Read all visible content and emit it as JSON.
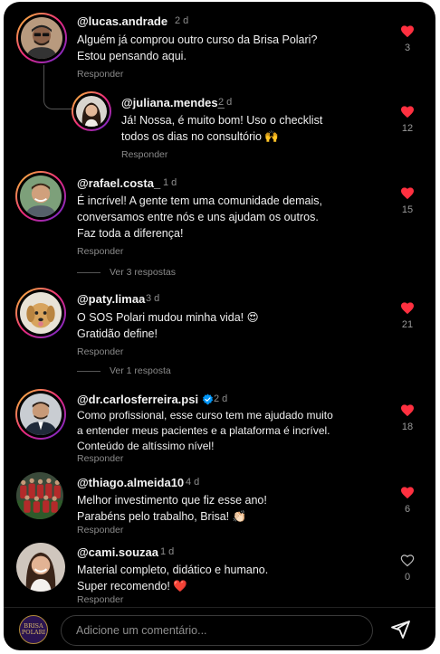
{
  "comments": [
    {
      "username": "@lucas.andrade",
      "time": "2 d",
      "lines": [
        "Alguém já comprou outro curso da Brisa Polari?",
        "Estou pensando aqui."
      ],
      "reply": "Responder",
      "likes": "3",
      "liked": true
    },
    {
      "username": "@juliana.mendes_",
      "time": "2 d",
      "lines": [
        "Já! Nossa, é muito bom! Uso o checklist",
        "todos os dias no consultório 🙌"
      ],
      "reply": "Responder",
      "likes": "12",
      "liked": true
    },
    {
      "username": "@rafael.costa_",
      "time": "1 d",
      "lines": [
        "É incrível! A gente tem uma comunidade demais,",
        "conversamos entre nós e uns ajudam os outros.",
        "Faz toda a diferença!"
      ],
      "reply": "Responder",
      "view_replies": "Ver 3 respostas",
      "likes": "15",
      "liked": true
    },
    {
      "username": "@paty.limaa",
      "time": "3 d",
      "lines": [
        "O SOS Polari mudou minha vida! 😍",
        "Gratidão define!"
      ],
      "reply": "Responder",
      "view_replies": "Ver 1 resposta",
      "likes": "21",
      "liked": true
    },
    {
      "username": "@dr.carlosferreira.psi",
      "time": "2 d",
      "verified": true,
      "lines": [
        "Como profissional, esse curso tem me ajudado muito",
        "a entender meus pacientes e a plataforma é incrível.",
        "Conteúdo de altíssimo nível!"
      ],
      "reply": "Responder",
      "likes": "18",
      "liked": true
    },
    {
      "username": "@thiago.almeida10",
      "time": "4 d",
      "lines": [
        "Melhor investimento que fiz esse ano!",
        "Parabéns pelo trabalho, Brisa! 👏🏻"
      ],
      "reply": "Responder",
      "likes": "6",
      "liked": true
    },
    {
      "username": "@cami.souzaa",
      "time": "1 d",
      "lines": [
        "Material completo, didático e humano.",
        "Super recomendo! ❤️"
      ],
      "reply": "Responder",
      "likes": "0",
      "liked": false
    }
  ],
  "composer": {
    "placeholder": "Adicione um comentário...",
    "brand_line1": "BRISA",
    "brand_line2": "POLARI"
  },
  "colors": {
    "like_red": "#ff3040",
    "background": "#000000",
    "verified_blue": "#0095f6"
  },
  "icons": {
    "like": "heart-icon",
    "send": "send-icon",
    "verified": "verified-badge-icon"
  }
}
